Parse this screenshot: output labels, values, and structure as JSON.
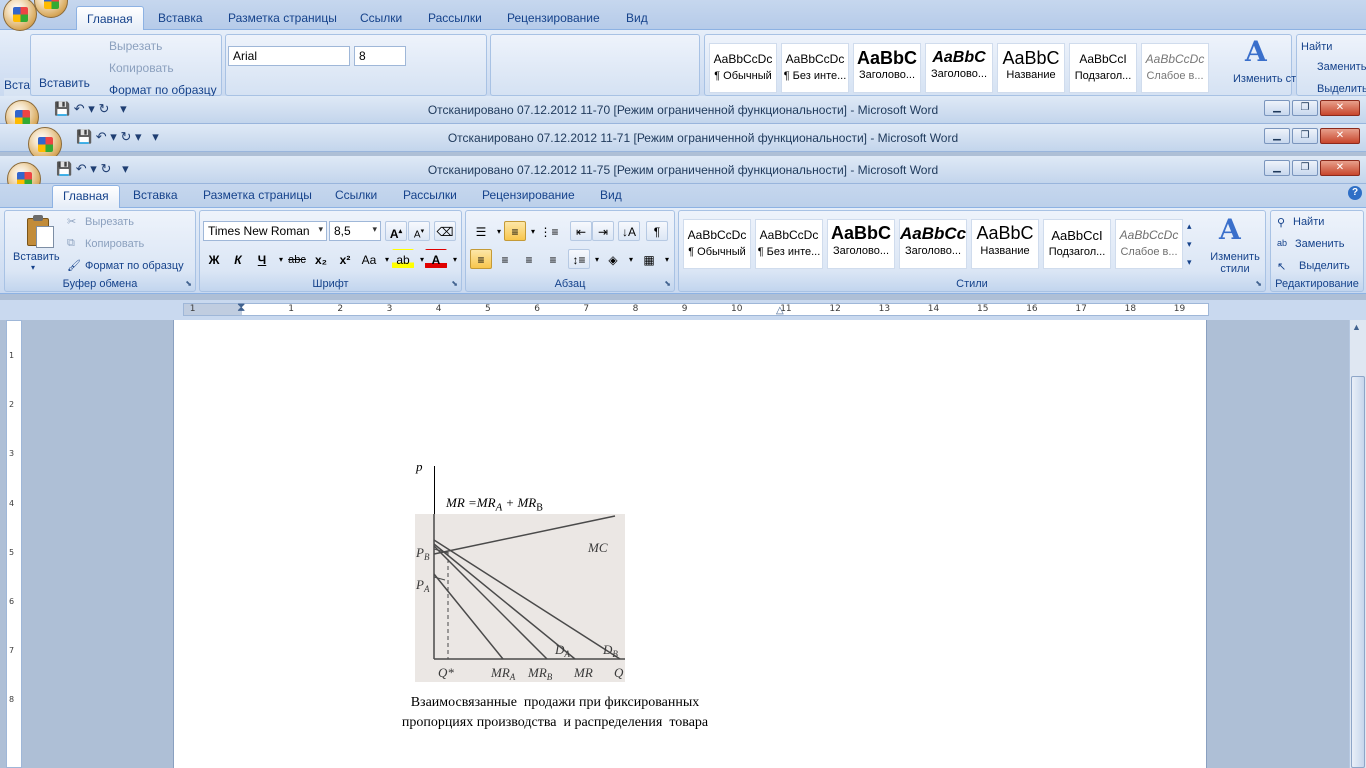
{
  "bg_window1": {
    "tabs": [
      "Главная",
      "Вставка",
      "Разметка страницы",
      "Ссылки",
      "Рассылки",
      "Рецензирование",
      "Вид"
    ],
    "paste_label": "Вставить",
    "insert_tiny": "Вста",
    "cut": "Вырезать",
    "copy": "Копировать",
    "format_painter": "Формат по образцу",
    "font": "Arial",
    "size": "8",
    "change_styles": "Изменить стили",
    "find": "Найти",
    "replace": "Заменить",
    "select": "Выделить",
    "styles": [
      {
        "sample": "AaBbCcDc",
        "name": "¶ Обычный"
      },
      {
        "sample": "AaBbCcDc",
        "name": "¶ Без инте..."
      },
      {
        "sample": "AaBbC",
        "name": "Заголово..."
      },
      {
        "sample": "AaBbC",
        "name": "Заголово..."
      },
      {
        "sample": "AaBbC",
        "name": "Название"
      },
      {
        "sample": "AaBbCcI",
        "name": "Подзагол..."
      },
      {
        "sample": "AaBbCcDc",
        "name": "Слабое в..."
      }
    ]
  },
  "bg_window2": {
    "title": "Отсканировано 07.12.2012 11-70 [Режим ограниченной функциональности]  -  Microsoft Word"
  },
  "bg_window3": {
    "title": "Отсканировано 07.12.2012 11-71 [Режим ограниченной функциональности]  -  Microsoft Word"
  },
  "active_window": {
    "title": "Отсканировано 07.12.2012 11-75 [Режим ограниченной функциональности]  -  Microsoft Word",
    "tabs": [
      "Главная",
      "Вставка",
      "Разметка страницы",
      "Ссылки",
      "Рассылки",
      "Рецензирование",
      "Вид"
    ],
    "clipboard": {
      "paste": "Вставить",
      "cut": "Вырезать",
      "copy": "Копировать",
      "format_painter": "Формат по образцу",
      "group_label": "Буфер обмена"
    },
    "font": {
      "name": "Times New Roman",
      "size": "8,5",
      "group_label": "Шрифт",
      "bold": "Ж",
      "italic": "К",
      "underline": "Ч",
      "strike": "abc",
      "subscript": "x₂",
      "superscript": "x²",
      "change_case": "Aa"
    },
    "paragraph": {
      "group_label": "Абзац"
    },
    "styles": {
      "group_label": "Стили",
      "change_styles": "Изменить стили",
      "items": [
        {
          "sample": "AaBbCcDc",
          "name": "¶ Обычный"
        },
        {
          "sample": "AaBbCcDc",
          "name": "¶ Без инте..."
        },
        {
          "sample": "AaBbC",
          "name": "Заголово..."
        },
        {
          "sample": "AaBbCc",
          "name": "Заголово..."
        },
        {
          "sample": "AaBbC",
          "name": "Название"
        },
        {
          "sample": "AaBbCcI",
          "name": "Подзагол..."
        },
        {
          "sample": "AaBbCcDc",
          "name": "Слабое в..."
        }
      ]
    },
    "editing": {
      "group_label": "Редактирование",
      "find": "Найти",
      "replace": "Заменить",
      "select": "Выделить"
    }
  },
  "ruler_numbers": [
    "2",
    "1",
    "1",
    "2",
    "3",
    "4",
    "5",
    "6",
    "7",
    "8",
    "9",
    "10",
    "11",
    "12",
    "13",
    "14",
    "15",
    "16",
    "17",
    "18",
    "19"
  ],
  "vruler_numbers": [
    "1",
    "2",
    "3",
    "4",
    "5",
    "6",
    "7",
    "8"
  ],
  "document": {
    "figure": {
      "axis_y": "p",
      "equation": "MR =MR",
      "eq_sub_a": "A",
      "eq_plus": " + MR",
      "eq_sub_b": "B",
      "labels": {
        "pb": "P",
        "pb_sub": "B",
        "pa": "P",
        "pa_sub": "A",
        "mc": "MC",
        "q_star": "Q*",
        "mra": "MR",
        "mra_sub": "A",
        "mrb": "MR",
        "mrb_sub": "B",
        "mr": "MR",
        "da": "D",
        "da_sub": "A",
        "db": "D",
        "db_sub": "B",
        "q": "Q"
      }
    },
    "caption_line1": "Взаимосвязанные  продажи при фиксированных",
    "caption_line2": "пропорциях производства  и распределения  товара"
  }
}
